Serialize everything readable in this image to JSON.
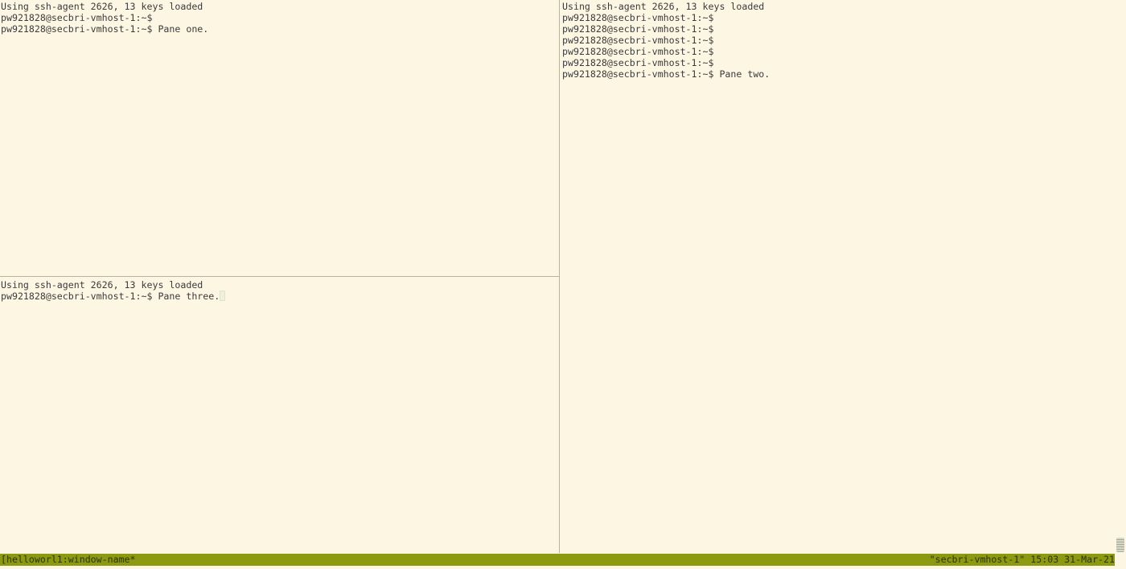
{
  "panes": {
    "one": {
      "lines": [
        "Using ssh-agent 2626, 13 keys loaded",
        "pw921828@secbri-vmhost-1:~$",
        "pw921828@secbri-vmhost-1:~$ Pane one."
      ]
    },
    "two": {
      "lines": [
        "Using ssh-agent 2626, 13 keys loaded",
        "pw921828@secbri-vmhost-1:~$",
        "pw921828@secbri-vmhost-1:~$",
        "pw921828@secbri-vmhost-1:~$",
        "pw921828@secbri-vmhost-1:~$",
        "pw921828@secbri-vmhost-1:~$",
        "pw921828@secbri-vmhost-1:~$ Pane two."
      ]
    },
    "three": {
      "lines": [
        "Using ssh-agent 2626, 13 keys loaded",
        "pw921828@secbri-vmhost-1:~$ Pane three."
      ]
    }
  },
  "status_bar": {
    "session_window": "[helloworl1:window-name*",
    "host": "\"secbri-vmhost-1\"",
    "time": "15:03",
    "date": "31-Mar-21"
  },
  "colors": {
    "background": "#fdf6e3",
    "status_bar": "#8b9a10",
    "divider": "#b9b29c",
    "text": "#3b3b3b"
  }
}
